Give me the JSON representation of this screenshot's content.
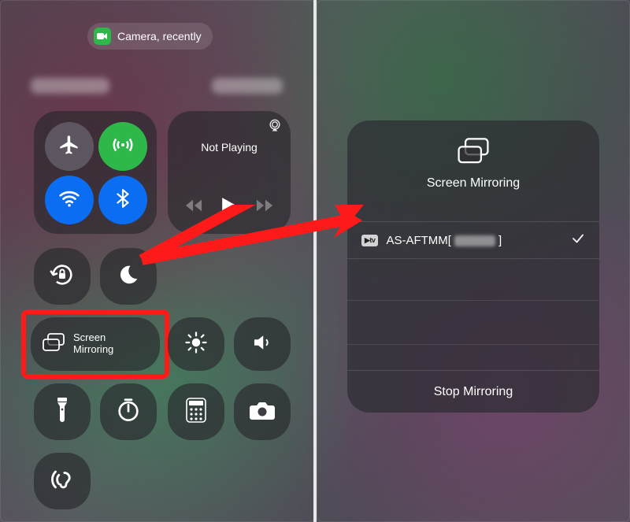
{
  "privacy": {
    "camera_label": "Camera, recently"
  },
  "media": {
    "not_playing": "Not Playing"
  },
  "screen_mirroring_tile": {
    "line1": "Screen",
    "line2": "Mirroring"
  },
  "dialog": {
    "title": "Screen Mirroring",
    "device_badge": "▶tv",
    "device_name": "AS-AFTMM[",
    "device_name_suffix": "]",
    "stop_label": "Stop Mirroring"
  }
}
